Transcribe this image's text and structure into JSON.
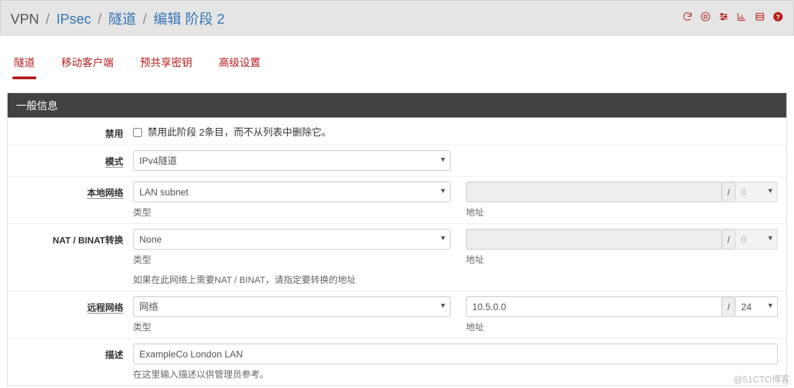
{
  "breadcrumb": {
    "root": "VPN",
    "l1": "IPsec",
    "l2": "隧道",
    "current": "编辑 阶段 2"
  },
  "tabs": [
    {
      "key": "tunnels",
      "label": "隧道",
      "active": true
    },
    {
      "key": "mobile",
      "label": "移动客户端",
      "active": false
    },
    {
      "key": "psk",
      "label": "预共享密钥",
      "active": false
    },
    {
      "key": "adv",
      "label": "高级设置",
      "active": false
    }
  ],
  "panel": {
    "title": "一般信息"
  },
  "fields": {
    "disabled": {
      "label": "禁用",
      "text": "禁用此阶段 2条目，而不从列表中删除它。",
      "checked": false
    },
    "mode": {
      "label": "模式",
      "value": "IPv4隧道"
    },
    "localnet": {
      "label": "本地网络",
      "type_value": "LAN subnet",
      "type_help": "类型",
      "addr_value": "",
      "addr_help": "地址",
      "mask": "0",
      "addr_disabled": true
    },
    "nat": {
      "label": "NAT / BINAT转换",
      "type_value": "None",
      "type_help": "类型",
      "addr_value": "",
      "addr_help": "地址",
      "mask": "0",
      "addr_disabled": true,
      "extra_help": "如果在此网络上需要NAT / BINAT，请指定要转换的地址"
    },
    "remotenet": {
      "label": "远程网络",
      "type_value": "网络",
      "type_help": "类型",
      "addr_value": "10.5.0.0",
      "addr_help": "地址",
      "mask": "24",
      "addr_disabled": false
    },
    "descr": {
      "label": "描述",
      "value": "ExampleCo London LAN",
      "help": "在这里输入描述以供管理员参考。"
    }
  },
  "slash": "/",
  "watermark": "@51CTO博客"
}
